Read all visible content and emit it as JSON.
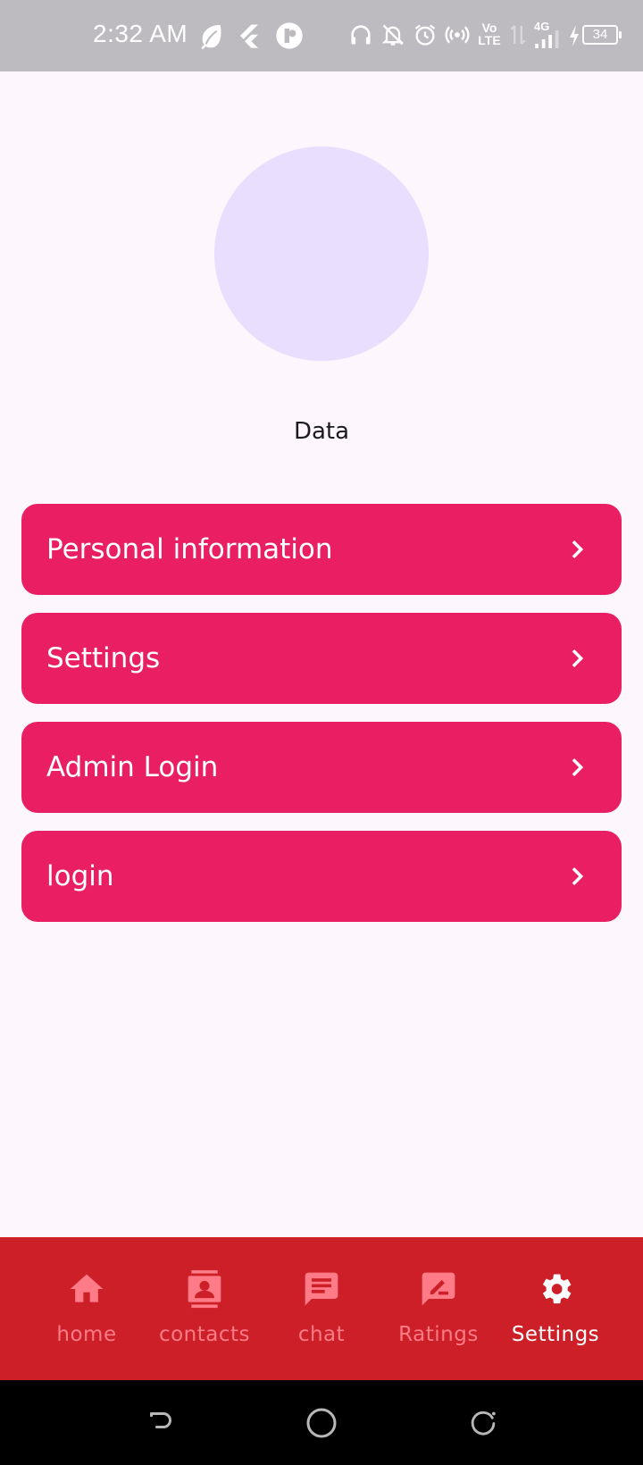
{
  "status_bar": {
    "time": "2:32 AM",
    "network": "4G",
    "volte": "Vo LTE",
    "battery": "34"
  },
  "profile": {
    "name": "Data"
  },
  "menu": [
    {
      "label": "Personal information"
    },
    {
      "label": "Settings"
    },
    {
      "label": "Admin Login"
    },
    {
      "label": "login"
    }
  ],
  "bottom_nav": [
    {
      "label": "home",
      "icon": "home-icon"
    },
    {
      "label": "contacts",
      "icon": "contacts-icon"
    },
    {
      "label": "chat",
      "icon": "chat-icon"
    },
    {
      "label": "Ratings",
      "icon": "rate-review-icon"
    },
    {
      "label": "Settings",
      "icon": "gear-icon",
      "active": true
    }
  ],
  "colors": {
    "status_bar": "#bdbbbf",
    "background": "#fdf7fd",
    "avatar": "#e9defe",
    "menu_item": "#e91e63",
    "bottom_nav": "#cc1f27",
    "nav_inactive": "#ff7b87",
    "nav_active": "#ffffff"
  }
}
